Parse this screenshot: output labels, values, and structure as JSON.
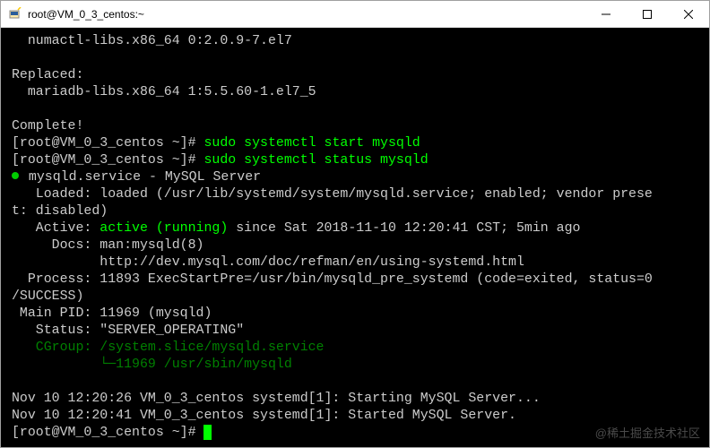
{
  "titlebar": {
    "title": "root@VM_0_3_centos:~"
  },
  "terminal": {
    "l01": "  numactl-libs.x86_64 0:2.0.9-7.el7",
    "l02": "",
    "l03": "Replaced:",
    "l04": "  mariadb-libs.x86_64 1:5.5.60-1.el7_5",
    "l05": "",
    "l06": "Complete!",
    "l07_prompt": "[root@VM_0_3_centos ~]# ",
    "l07_cmd": "sudo systemctl start mysqld",
    "l08_prompt": "[root@VM_0_3_centos ~]# ",
    "l08_cmd": "sudo systemctl status mysqld",
    "l09": " mysqld.service - MySQL Server",
    "l10": "   Loaded: loaded (/usr/lib/systemd/system/mysqld.service; enabled; vendor prese",
    "l11": "t: disabled)",
    "l12_a": "   Active: ",
    "l12_b": "active (running)",
    "l12_c": " since Sat 2018-11-10 12:20:41 CST; 5min ago",
    "l13": "     Docs: man:mysqld(8)",
    "l14": "           http://dev.mysql.com/doc/refman/en/using-systemd.html",
    "l15": "  Process: 11893 ExecStartPre=/usr/bin/mysqld_pre_systemd (code=exited, status=0",
    "l16": "/SUCCESS)",
    "l17": " Main PID: 11969 (mysqld)",
    "l18": "   Status: \"SERVER_OPERATING\"",
    "l19": "   CGroup: /system.slice/mysqld.service",
    "l20": "           └─11969 /usr/sbin/mysqld",
    "l21": "",
    "l22": "Nov 10 12:20:26 VM_0_3_centos systemd[1]: Starting MySQL Server...",
    "l23": "Nov 10 12:20:41 VM_0_3_centos systemd[1]: Started MySQL Server.",
    "l24_prompt": "[root@VM_0_3_centos ~]# "
  },
  "watermark": "@稀土掘金技术社区"
}
